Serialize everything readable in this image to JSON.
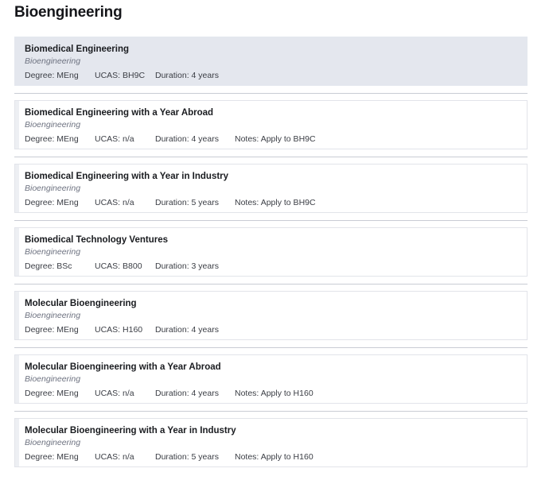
{
  "page": {
    "title": "Bioengineering"
  },
  "labels": {
    "degree": "Degree:",
    "ucas": "UCAS:",
    "duration": "Duration:",
    "notes": "Notes:"
  },
  "colors": {
    "selected_card_background": "#e4e7ee",
    "card_background": "#ffffff",
    "card_border": "#e2e4ea",
    "divider": "#c9ccd4",
    "title_text": "#15161a",
    "department_text": "#6d7280",
    "meta_text": "#3a3d44"
  },
  "courses": [
    {
      "name": "Biomedical Engineering",
      "department": "Bioengineering",
      "degree": "MEng",
      "ucas": "BH9C",
      "duration": "4 years",
      "notes": "",
      "selected": true
    },
    {
      "name": "Biomedical Engineering with a Year Abroad",
      "department": "Bioengineering",
      "degree": "MEng",
      "ucas": "n/a",
      "duration": "4 years",
      "notes": "Apply to BH9C",
      "selected": false
    },
    {
      "name": "Biomedical Engineering with a Year in Industry",
      "department": "Bioengineering",
      "degree": "MEng",
      "ucas": "n/a",
      "duration": "5 years",
      "notes": "Apply to BH9C",
      "selected": false
    },
    {
      "name": "Biomedical Technology Ventures",
      "department": "Bioengineering",
      "degree": "BSc",
      "ucas": "B800",
      "duration": "3 years",
      "notes": "",
      "selected": false
    },
    {
      "name": "Molecular Bioengineering",
      "department": "Bioengineering",
      "degree": "MEng",
      "ucas": "H160",
      "duration": "4 years",
      "notes": "",
      "selected": false
    },
    {
      "name": "Molecular Bioengineering with a Year Abroad",
      "department": "Bioengineering",
      "degree": "MEng",
      "ucas": "n/a",
      "duration": "4 years",
      "notes": "Apply to H160",
      "selected": false
    },
    {
      "name": "Molecular Bioengineering with a Year in Industry",
      "department": "Bioengineering",
      "degree": "MEng",
      "ucas": "n/a",
      "duration": "5 years",
      "notes": "Apply to H160",
      "selected": false
    }
  ]
}
